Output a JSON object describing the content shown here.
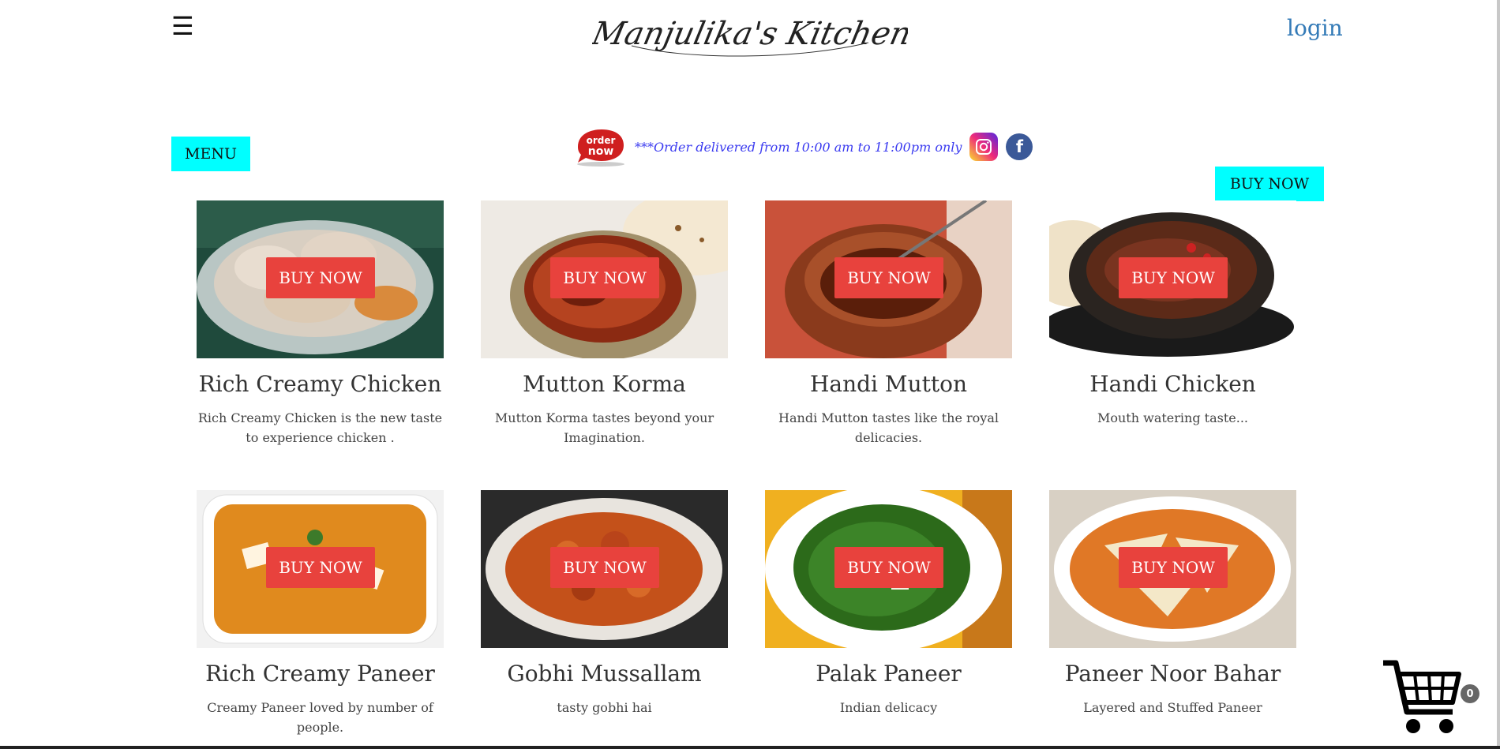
{
  "header": {
    "brand": "Manjulika's Kitchen",
    "login_label": "login"
  },
  "menu_label": "MENU",
  "announcement": {
    "badge_line1": "order",
    "badge_line2": "now",
    "text": "***Order delivered from 10:00 am to 11:00pm only"
  },
  "buy_now_top": "BUY NOW",
  "products": [
    {
      "title": "Rich Creamy Chicken",
      "desc": "Rich Creamy Chicken is the new taste to experience chicken .",
      "buy": "BUY NOW"
    },
    {
      "title": "Mutton Korma",
      "desc": "Mutton Korma tastes beyond your Imagination.",
      "buy": "BUY NOW"
    },
    {
      "title": "Handi Mutton",
      "desc": "Handi Mutton tastes like the royal delicacies.",
      "buy": "BUY NOW"
    },
    {
      "title": "Handi Chicken",
      "desc": "Mouth watering taste...",
      "buy": "BUY NOW"
    },
    {
      "title": "Rich Creamy Paneer",
      "desc": "Creamy Paneer loved by number of people.",
      "buy": "BUY NOW"
    },
    {
      "title": "Gobhi Mussallam",
      "desc": "tasty gobhi hai",
      "buy": "BUY NOW"
    },
    {
      "title": "Palak Paneer",
      "desc": "Indian delicacy",
      "buy": "BUY NOW"
    },
    {
      "title": "Paneer Noor Bahar",
      "desc": "Layered and Stuffed Paneer",
      "buy": "BUY NOW"
    }
  ],
  "cart": {
    "count": "0"
  }
}
